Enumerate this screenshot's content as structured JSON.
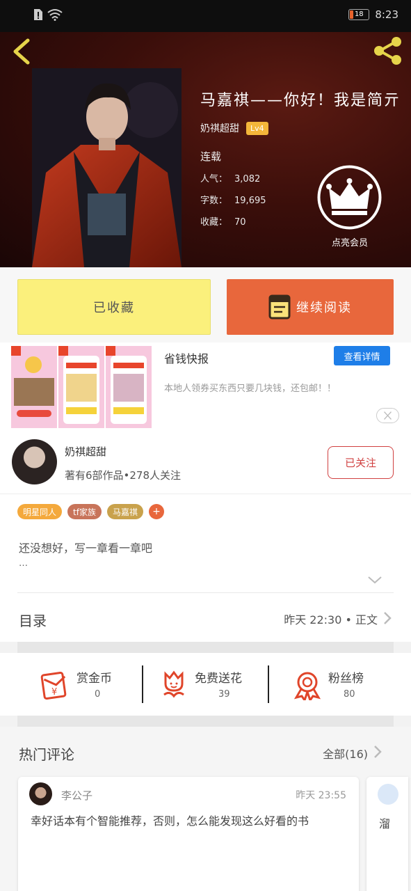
{
  "status_bar": {
    "time": "8:23",
    "battery": "18"
  },
  "book": {
    "title": "马嘉祺——你好！我是简亓",
    "author": "奶祺超甜",
    "level": "Lv4",
    "status": "连载",
    "stats": [
      {
        "label": "人气：",
        "value": "3,082"
      },
      {
        "label": "字数：",
        "value": "19,695"
      },
      {
        "label": "收藏：",
        "value": "70"
      }
    ],
    "vip_label": "点亮会员"
  },
  "actions": {
    "collected": "已收藏",
    "read": "继续阅读"
  },
  "ad": {
    "title": "省钱快报",
    "button": "查看详情",
    "description": "本地人领券买东西只要几块钱，还包邮！！"
  },
  "author_card": {
    "name": "奶祺超甜",
    "meta": "著有6部作品•278人关注",
    "follow": "已关注"
  },
  "tags": [
    {
      "label": "明星同人",
      "color": "#f4a93c"
    },
    {
      "label": "tf家族",
      "color": "#c8745a"
    },
    {
      "label": "马嘉祺",
      "color": "#c9a24c"
    },
    {
      "label": "+",
      "color": "#e8673c"
    }
  ],
  "intro": {
    "text": "还没想好，写一章看一章吧",
    "more": "…"
  },
  "catalog": {
    "title": "目录",
    "info": "昨天 22:30 • 正文"
  },
  "stats_row": [
    {
      "name": "赏金币",
      "value": "0",
      "icon": "red-envelope-icon"
    },
    {
      "name": "免费送花",
      "value": "39",
      "icon": "flower-icon"
    },
    {
      "name": "粉丝榜",
      "value": "80",
      "icon": "medal-icon"
    }
  ],
  "comments": {
    "title": "热门评论",
    "all": "全部(16)",
    "items": [
      {
        "user": "李公子",
        "time": "昨天 23:55",
        "text": "幸好话本有个智能推荐，否则，怎么能发现这么好看的书"
      },
      {
        "text": "溜"
      }
    ]
  },
  "colors": {
    "accent": "#e8673c",
    "collected": "#fbf07c",
    "follow": "#d04040",
    "ad_button": "#1e7ee8"
  }
}
